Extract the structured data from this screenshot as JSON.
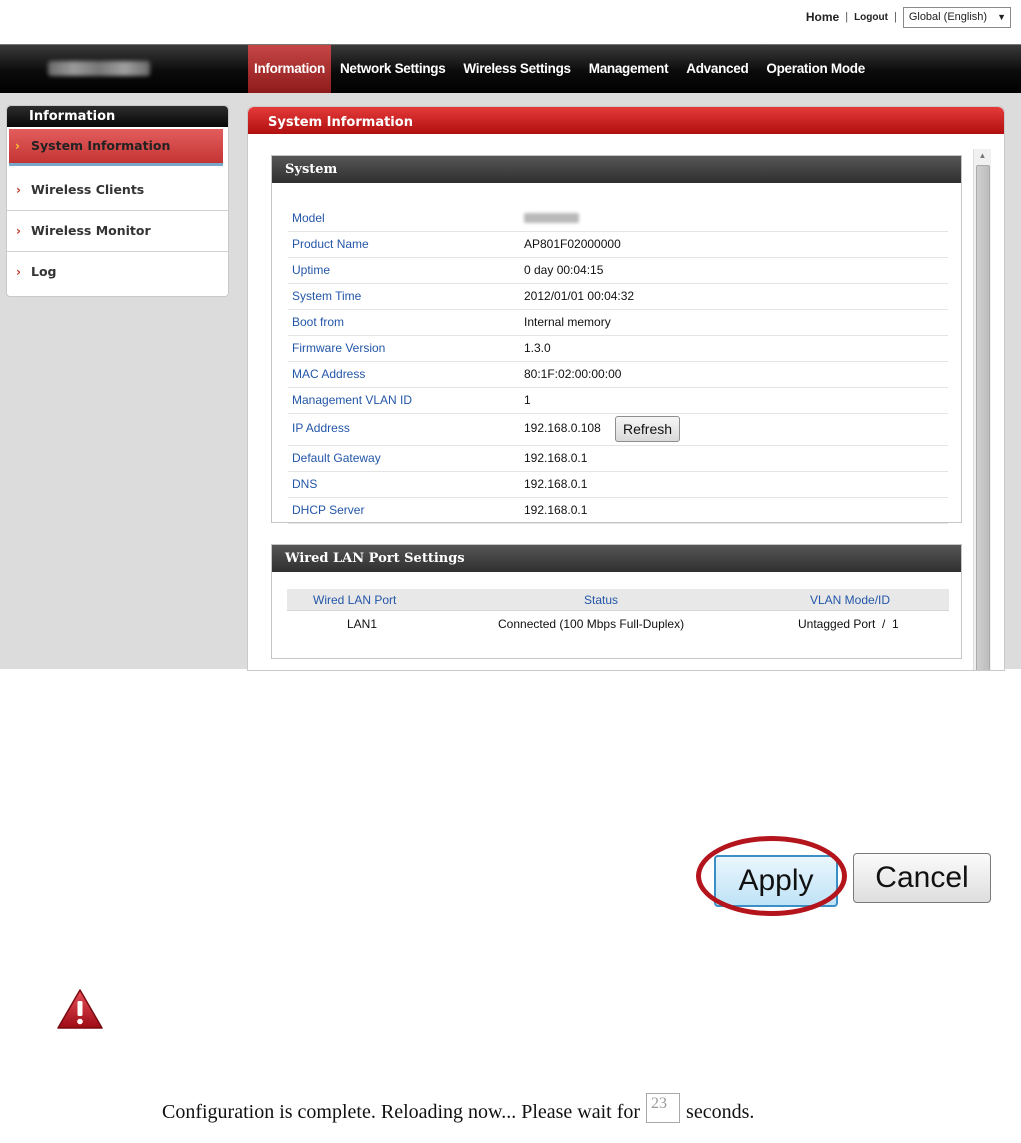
{
  "top_links": {
    "home": "Home",
    "logout": "Logout",
    "language": "Global (English)"
  },
  "nav": {
    "tabs": [
      "Information",
      "Network Settings",
      "Wireless Settings",
      "Management",
      "Advanced",
      "Operation Mode"
    ],
    "active": "Information"
  },
  "sidebar": {
    "heading": "Information",
    "items": [
      {
        "label": "System Information",
        "active": true
      },
      {
        "label": "Wireless Clients",
        "active": false
      },
      {
        "label": "Wireless Monitor",
        "active": false
      },
      {
        "label": "Log",
        "active": false
      }
    ]
  },
  "panel": {
    "title": "System Information",
    "system": {
      "heading": "System",
      "rows": [
        {
          "key": "Model",
          "value": ""
        },
        {
          "key": "Product Name",
          "value": "AP801F02000000"
        },
        {
          "key": "Uptime",
          "value": "0 day 00:04:15"
        },
        {
          "key": "System Time",
          "value": "2012/01/01 00:04:32"
        },
        {
          "key": "Boot from",
          "value": "Internal memory"
        },
        {
          "key": "Firmware Version",
          "value": "1.3.0"
        },
        {
          "key": "MAC Address",
          "value": "80:1F:02:00:00:00"
        },
        {
          "key": "Management VLAN ID",
          "value": "1"
        },
        {
          "key": "IP Address",
          "value": "192.168.0.108"
        },
        {
          "key": "Default Gateway",
          "value": "192.168.0.1"
        },
        {
          "key": "DNS",
          "value": "192.168.0.1"
        },
        {
          "key": "DHCP Server",
          "value": "192.168.0.1"
        }
      ],
      "refresh_label": "Refresh"
    },
    "wired_lan": {
      "heading": "Wired LAN Port Settings",
      "columns": [
        "Wired LAN Port",
        "Status",
        "VLAN Mode/ID"
      ],
      "rows": [
        {
          "port": "LAN1",
          "status": "Connected (100 Mbps Full-Duplex)",
          "vlan": "Untagged Port  /  1"
        }
      ]
    }
  },
  "buttons": {
    "apply": "Apply",
    "cancel": "Cancel"
  },
  "message": {
    "before": "Configuration is complete. Reloading now... Please wait for",
    "countdown": "23",
    "after": "seconds."
  },
  "colors": {
    "accent_red": "#c41e1e",
    "highlight_circle": "#b4141c",
    "label_blue": "#2356a8"
  }
}
